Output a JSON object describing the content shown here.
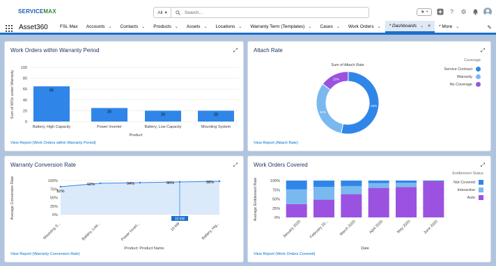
{
  "header": {
    "logo_part1": "SERVICE",
    "logo_part2": "MAX",
    "search_scope": "All",
    "search_placeholder": "Search..."
  },
  "nav": {
    "app_name": "Asset360",
    "items": [
      {
        "label": "FSL Max",
        "chevron": false
      },
      {
        "label": "Accounts",
        "chevron": true
      },
      {
        "label": "Contacts",
        "chevron": true
      },
      {
        "label": "Products",
        "chevron": true
      },
      {
        "label": "Assets",
        "chevron": true
      },
      {
        "label": "Locations",
        "chevron": true
      },
      {
        "label": "Warranty Term (Templates)",
        "chevron": true
      },
      {
        "label": "Cases",
        "chevron": true
      },
      {
        "label": "Work Orders",
        "chevron": true
      },
      {
        "label": "* Dashboards",
        "chevron": true,
        "active": true,
        "close": true
      },
      {
        "label": "* More",
        "chevron": true
      }
    ]
  },
  "cards": {
    "wo_warranty": {
      "title": "Work Orders within Warranty Period",
      "link": "View Report (Work Orders within Warranty Period)"
    },
    "attach_rate": {
      "title": "Attach Rate",
      "link": "View Report (Attach Rate)"
    },
    "conversion": {
      "title": "Warranty Conversion Rate",
      "link": "View Report (Warranty Conversion Rate)"
    },
    "covered": {
      "title": "Work Orders Covered",
      "link": "View Report (Work Orders Covered)"
    }
  },
  "chart_data": [
    {
      "type": "bar",
      "ylabel": "Sum of WOs under Warranty",
      "xlabel": "Product",
      "categories": [
        "Battery, High Capacity",
        "Power Inverter",
        "Battery, Low Capacity",
        "Mounting System"
      ],
      "values": [
        65,
        25,
        20,
        20
      ],
      "ylim": [
        0,
        100
      ],
      "yticks": [
        0,
        20,
        40,
        60,
        80,
        100
      ],
      "color": "#2f86e8"
    },
    {
      "type": "pie",
      "donut": true,
      "title": "Sum of Attach Rate",
      "legend_title": "Coverage",
      "slices": [
        {
          "name": "Service Contract",
          "value": 53,
          "label": "53%",
          "color": "#2f86e8"
        },
        {
          "name": "Warranty",
          "value": 32,
          "label": "32%",
          "color": "#7ab8f0"
        },
        {
          "name": "No Coverage",
          "value": 15,
          "label": "15%",
          "color": "#9b52e0"
        }
      ]
    },
    {
      "type": "area",
      "ylabel": "Average Conversion Rate",
      "xlabel": "Product: Product Name",
      "categories": [
        "Mounting S...",
        "Battery, Low...",
        "Power Invert...",
        "10 kW",
        "Battery, Hig..."
      ],
      "values": [
        82,
        92,
        94,
        96,
        98
      ],
      "labels": [
        "82%",
        "92%",
        "94%",
        "96%",
        "98%"
      ],
      "yticks": [
        "0%",
        "25%",
        "50%",
        "75%",
        "100%"
      ],
      "ylim": [
        0,
        100
      ],
      "highlight": "10 kW",
      "color": "#2f86e8"
    },
    {
      "type": "bar",
      "stacked": true,
      "ylabel": "Average Entitlement Rate",
      "xlabel": "Date",
      "legend_title": "Entitlement Status",
      "categories": [
        "January 2020",
        "February 20...",
        "March 2020",
        "April 2020",
        "May 2020",
        "June 2020"
      ],
      "yticks": [
        "0%",
        "25%",
        "50%",
        "75%",
        "100%"
      ],
      "series": [
        {
          "name": "Auto",
          "color": "#9b52e0",
          "values": [
            36,
            48,
            63,
            80,
            82,
            98
          ]
        },
        {
          "name": "Interactive",
          "color": "#7ab8f0",
          "values": [
            40,
            35,
            22,
            13,
            12,
            0
          ]
        },
        {
          "name": "Not Covered",
          "color": "#2f86e8",
          "values": [
            24,
            17,
            15,
            7,
            6,
            2
          ]
        }
      ]
    }
  ]
}
